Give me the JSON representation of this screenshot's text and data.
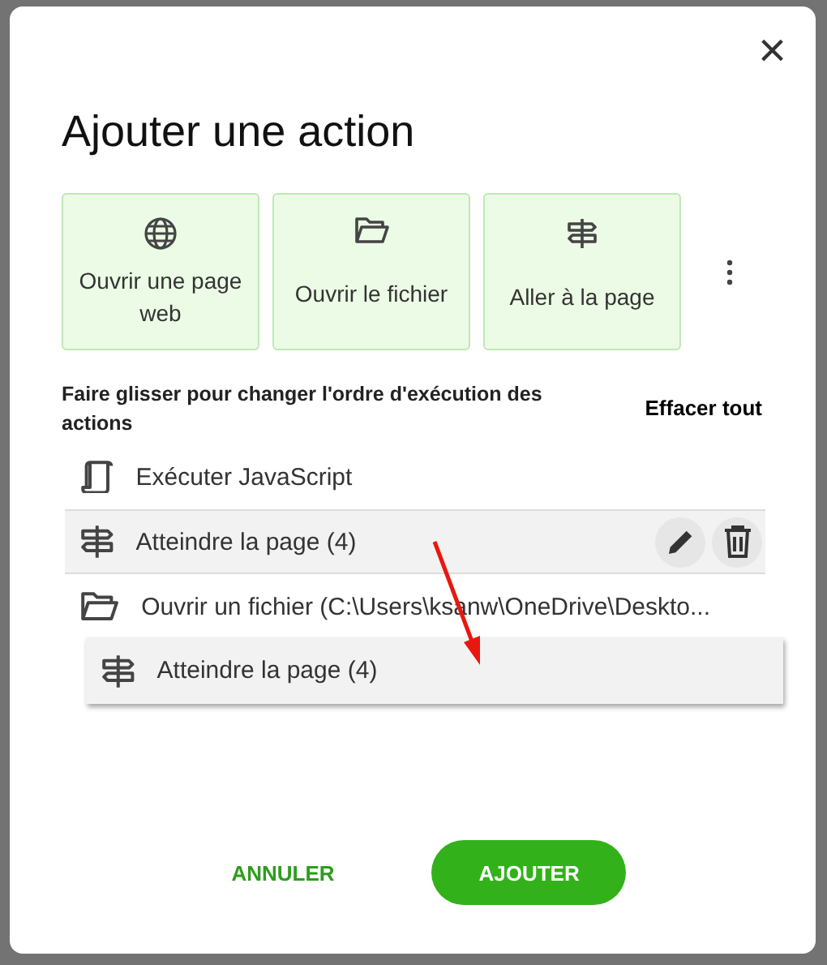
{
  "dialog": {
    "title": "Ajouter une action",
    "close_label": "×"
  },
  "action_cards": [
    {
      "kind": "globe",
      "label": "Ouvrir une page web"
    },
    {
      "kind": "folder",
      "label": "Ouvrir le fichier"
    },
    {
      "kind": "signpost",
      "label": "Aller à la page"
    }
  ],
  "instructions": "Faire glisser pour changer l'ordre d'exécution des actions",
  "clear_all": "Effacer tout",
  "actions": [
    {
      "kind": "script",
      "label": "Exécuter JavaScript",
      "selected": false
    },
    {
      "kind": "signpost",
      "label": "Atteindre la page (4)",
      "selected": true
    },
    {
      "kind": "folder",
      "label": "Ouvrir un fichier (C:\\Users\\ksanw\\OneDrive\\Deskto...",
      "selected": false
    }
  ],
  "drag_preview": {
    "kind": "signpost",
    "label": "Atteindre la page (4)"
  },
  "buttons": {
    "cancel": "ANNULER",
    "add": "AJOUTER"
  }
}
